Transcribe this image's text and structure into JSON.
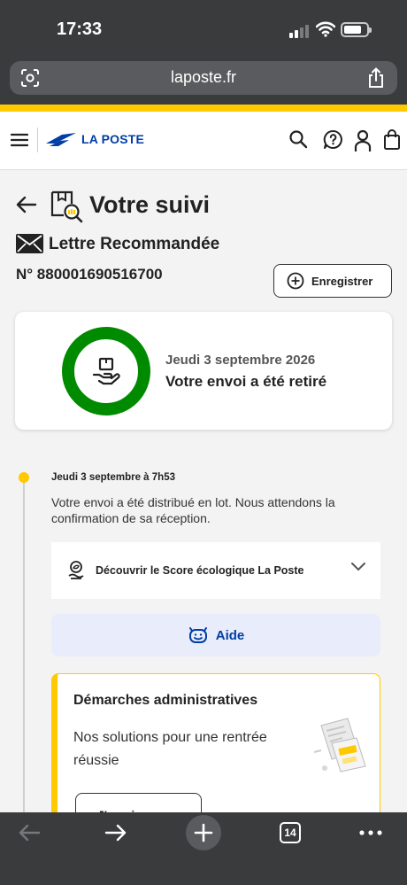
{
  "status_bar": {
    "time": "17:33"
  },
  "browser": {
    "url": "laposte.fr",
    "tab_count": "14"
  },
  "site_header": {
    "logo_text": "LA POSTE"
  },
  "page": {
    "title": "Votre suivi",
    "item_type": "Lettre Recommandée",
    "tracking_number": "N° 880001690516700",
    "save_button": "Enregistrer"
  },
  "status_card": {
    "date": "Jeudi 3 septembre 2026",
    "status": "Votre envoi a été retiré",
    "ring_color": "#008a00"
  },
  "timeline": [
    {
      "date": "Jeudi 3 septembre à 7h53",
      "text": "Votre envoi a été distribué en lot. Nous attendons la confirmation de sa réception."
    }
  ],
  "eco_score": {
    "label": "Découvrir le Score écologique La Poste"
  },
  "help": {
    "label": "Aide"
  },
  "promo": {
    "title": "Démarches administratives",
    "text": "Nos solutions pour une rentrée réussie",
    "button": "J'y vais"
  },
  "colors": {
    "brand_blue": "#003da5",
    "brand_yellow": "#ffc900"
  }
}
